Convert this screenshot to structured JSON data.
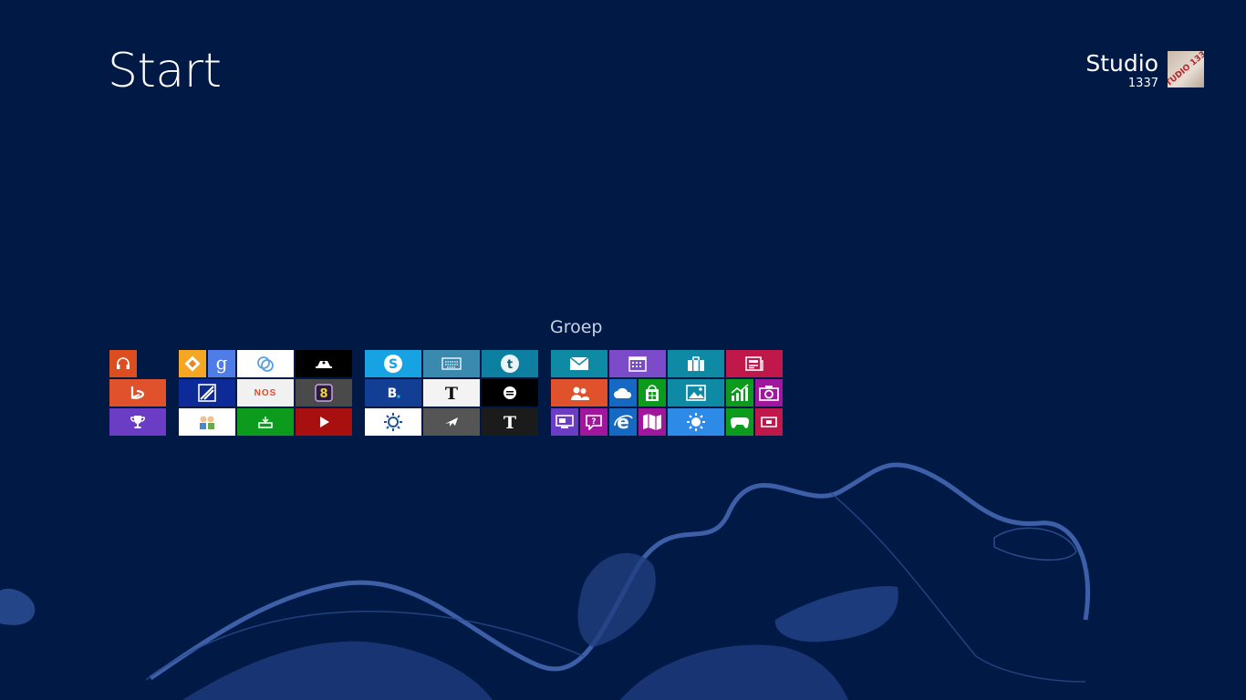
{
  "start": {
    "title": "Start"
  },
  "user": {
    "name": "Studio",
    "subtitle": "1337",
    "avatar_text": "STUDIO 1337"
  },
  "group": {
    "label": "Groep"
  },
  "colors": {
    "background": "#001a45",
    "ribbon": "#3c5fa8"
  },
  "tiles": [
    {
      "name": "music-tile",
      "icon": "headphones-icon",
      "color": "#dc4e20"
    },
    {
      "name": "bing-tile",
      "icon": "bing-icon",
      "color": "#e0522b"
    },
    {
      "name": "games-trophy-tile",
      "icon": "trophy-icon",
      "color": "#6b3cc4"
    },
    {
      "name": "app-diamond-tile",
      "icon": "diamond-icon",
      "color": "#f5a623"
    },
    {
      "name": "google-tile",
      "icon": "google-icon",
      "color": "#4f7de8"
    },
    {
      "name": "ring-app-tile",
      "icon": "ring-icon",
      "color": "#ffffff"
    },
    {
      "name": "hats-app-tile",
      "icon": "hat-icon",
      "color": "#000000"
    },
    {
      "name": "stripe-app-tile",
      "icon": "stripe-icon",
      "color": "#0c2b99"
    },
    {
      "name": "nos-tile",
      "icon": "nos-icon",
      "color": "#f1f1f1",
      "text": "NOS"
    },
    {
      "name": "eight-app-tile",
      "icon": "eight-icon",
      "color": "#4a4a4a"
    },
    {
      "name": "people-cartoon-tile",
      "icon": "people-cartoon-icon",
      "color": "#ffffff"
    },
    {
      "name": "green-app-tile",
      "icon": "tray-icon",
      "color": "#0d9b1e"
    },
    {
      "name": "video-tile",
      "icon": "play-icon",
      "color": "#a81010"
    },
    {
      "name": "skype-tile",
      "icon": "skype-icon",
      "color": "#17a3e3"
    },
    {
      "name": "keyboard-tile",
      "icon": "keyboard-icon",
      "color": "#3a8ab0"
    },
    {
      "name": "tumblr-tile",
      "icon": "tumblr-icon",
      "color": "#0d7fa0"
    },
    {
      "name": "booking-tile",
      "icon": "booking-icon",
      "color": "#123f94"
    },
    {
      "name": "nytimes-tile-1",
      "icon": "nyt-icon",
      "color": "#f3f3f3"
    },
    {
      "name": "circle-app-tile",
      "icon": "circle-icon",
      "color": "#000000"
    },
    {
      "name": "weather-sun-tile",
      "icon": "sun-outline-icon",
      "color": "#ffffff"
    },
    {
      "name": "travel-tile",
      "icon": "plane-icon",
      "color": "#555555"
    },
    {
      "name": "nytimes-tile-2",
      "icon": "nyt-icon",
      "color": "#1b1b1b"
    },
    {
      "name": "mail-tile",
      "icon": "mail-icon",
      "color": "#0f8aa5"
    },
    {
      "name": "calendar-tile",
      "icon": "calendar-icon",
      "color": "#7b4bc9"
    },
    {
      "name": "store-bag-tile",
      "icon": "briefcase-icon",
      "color": "#0f8aa5"
    },
    {
      "name": "news-tile",
      "icon": "news-icon",
      "color": "#c0184a"
    },
    {
      "name": "people-tile",
      "icon": "people-icon",
      "color": "#e0522b"
    },
    {
      "name": "onedrive-tile",
      "icon": "cloud-icon",
      "color": "#1669c3"
    },
    {
      "name": "store-tile",
      "icon": "store-icon",
      "color": "#0d9b1e"
    },
    {
      "name": "photos-tile",
      "icon": "photo-icon",
      "color": "#0f8aa5"
    },
    {
      "name": "finance-tile",
      "icon": "chart-icon",
      "color": "#0d9b1e"
    },
    {
      "name": "camera-tile",
      "icon": "camera-icon",
      "color": "#a0179e"
    },
    {
      "name": "desktop-tile",
      "icon": "desktop-icon",
      "color": "#6b3cc4"
    },
    {
      "name": "help-tile",
      "icon": "help-icon",
      "color": "#a0179e"
    },
    {
      "name": "ie-tile",
      "icon": "ie-icon",
      "color": "#1669c3"
    },
    {
      "name": "maps-tile",
      "icon": "map-icon",
      "color": "#a0179e"
    },
    {
      "name": "weather-tile",
      "icon": "sun-icon",
      "color": "#2d8ae6"
    },
    {
      "name": "xbox-games-tile",
      "icon": "gamepad-icon",
      "color": "#0d9b1e"
    },
    {
      "name": "video-app-tile",
      "icon": "video-icon",
      "color": "#c0184a"
    }
  ]
}
